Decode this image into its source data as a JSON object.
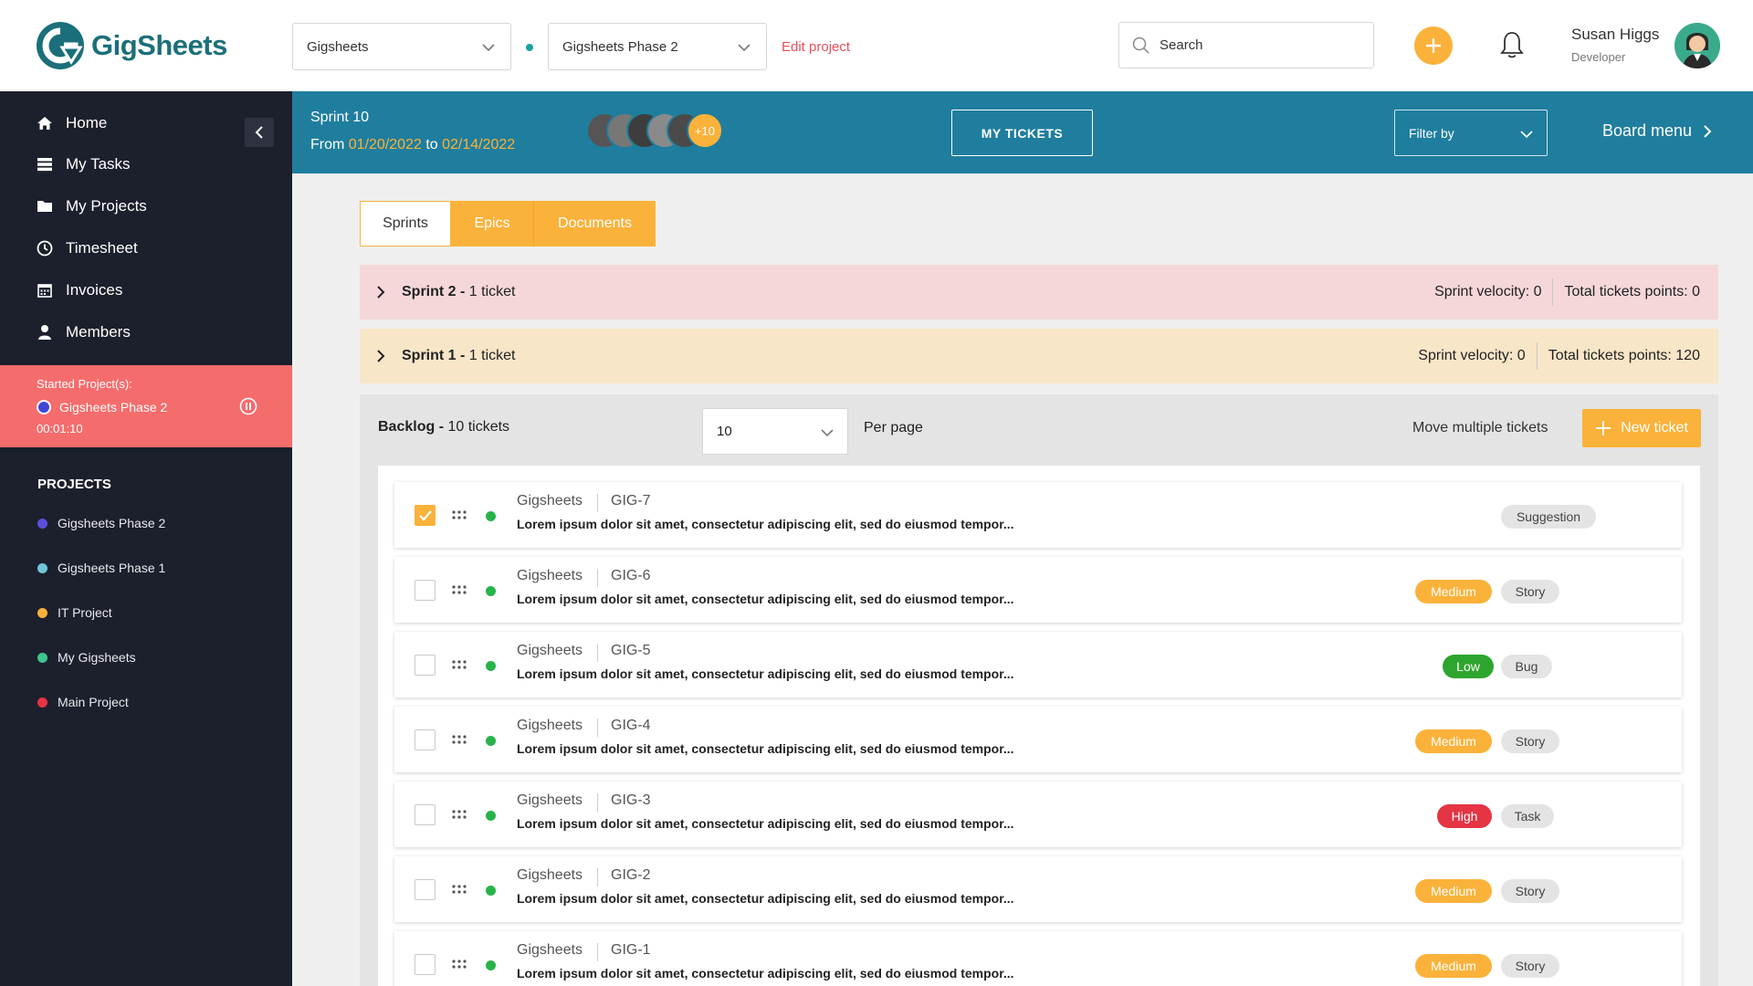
{
  "app": {
    "logo_text": "GigSheets",
    "workspace_select": "Gigsheets",
    "project_select": "Gigsheets Phase 2",
    "edit_project": "Edit project",
    "search_placeholder": "Search",
    "user_name": "Susan Higgs",
    "user_role": "Developer"
  },
  "sidebar": {
    "items": [
      {
        "label": "Home",
        "icon": "home-icon"
      },
      {
        "label": "My Tasks",
        "icon": "tasks-icon"
      },
      {
        "label": "My Projects",
        "icon": "folder-icon"
      },
      {
        "label": "Timesheet",
        "icon": "clock-icon"
      },
      {
        "label": "Invoices",
        "icon": "calendar-icon"
      },
      {
        "label": "Members",
        "icon": "user-icon"
      }
    ],
    "started": {
      "heading": "Started Project(s):",
      "project": "Gigsheets Phase 2",
      "timer": "00:01:10"
    },
    "projects_heading": "PROJECTS",
    "projects": [
      {
        "label": "Gigsheets Phase 2",
        "color": "#5b4fd9"
      },
      {
        "label": "Gigsheets Phase 1",
        "color": "#6ec6d9"
      },
      {
        "label": "IT Project",
        "color": "#fbb23a"
      },
      {
        "label": "My Gigsheets",
        "color": "#3fc58f"
      },
      {
        "label": "Main Project",
        "color": "#e53444"
      }
    ]
  },
  "sprint": {
    "title": "Sprint 10",
    "from_label": "From",
    "start": "01/20/2022",
    "to_label": "to",
    "end": "02/14/2022",
    "more_members": "+10",
    "my_tickets": "MY TICKETS",
    "filter_by": "Filter by",
    "board_menu": "Board menu"
  },
  "tabs": [
    "Sprints",
    "Epics",
    "Documents"
  ],
  "sprints": [
    {
      "name": "Sprint 2 -",
      "tickets": "1 ticket",
      "velocity": "Sprint velocity: 0",
      "points": "Total tickets points: 0",
      "bg": "#f5d7da"
    },
    {
      "name": "Sprint 1 -",
      "tickets": "1 ticket",
      "velocity": "Sprint velocity: 0",
      "points": "Total tickets points: 120",
      "bg": "#f8e6c8"
    }
  ],
  "backlog": {
    "title": "Backlog -",
    "count": "10 tickets",
    "per_page_value": "10",
    "per_page_label": "Per page",
    "move_multiple": "Move multiple tickets",
    "new_ticket": "New ticket"
  },
  "tickets": [
    {
      "project": "Gigsheets",
      "code": "GIG-7",
      "desc": "Lorem ipsum dolor sit amet, consectetur adipiscing elit, sed do eiusmod tempor...",
      "priority": "",
      "type": "Suggestion",
      "checked": true
    },
    {
      "project": "Gigsheets",
      "code": "GIG-6",
      "desc": "Lorem ipsum dolor sit amet, consectetur adipiscing elit, sed do eiusmod tempor...",
      "priority": "Medium",
      "type": "Story",
      "checked": false
    },
    {
      "project": "Gigsheets",
      "code": "GIG-5",
      "desc": "Lorem ipsum dolor sit amet, consectetur adipiscing elit, sed do eiusmod tempor...",
      "priority": "Low",
      "type": "Bug",
      "checked": false
    },
    {
      "project": "Gigsheets",
      "code": "GIG-4",
      "desc": "Lorem ipsum dolor sit amet, consectetur adipiscing elit, sed do eiusmod tempor...",
      "priority": "Medium",
      "type": "Story",
      "checked": false
    },
    {
      "project": "Gigsheets",
      "code": "GIG-3",
      "desc": "Lorem ipsum dolor sit amet, consectetur adipiscing elit, sed do eiusmod tempor...",
      "priority": "High",
      "type": "Task",
      "checked": false
    },
    {
      "project": "Gigsheets",
      "code": "GIG-2",
      "desc": "Lorem ipsum dolor sit amet, consectetur adipiscing elit, sed do eiusmod tempor...",
      "priority": "Medium",
      "type": "Story",
      "checked": false
    },
    {
      "project": "Gigsheets",
      "code": "GIG-1",
      "desc": "Lorem ipsum dolor sit amet, consectetur adipiscing elit, sed do eiusmod tempor...",
      "priority": "Medium",
      "type": "Story",
      "checked": false
    }
  ],
  "colors": {
    "accent": "#fbb23a",
    "header": "#1f7e9e",
    "sidebar": "#1c1f2c",
    "started": "#f56c6c"
  }
}
